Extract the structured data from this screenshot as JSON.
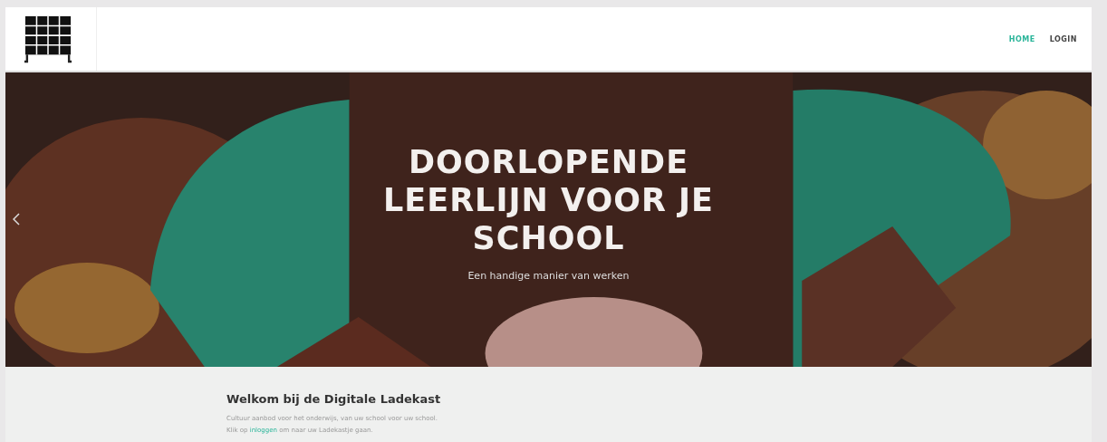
{
  "nav": [
    {
      "label": "HOME",
      "selected": true
    },
    {
      "label": "LOGIN",
      "selected": false
    }
  ],
  "hero": {
    "title": "DOORLOPENDE LEERLIJN VOOR JE SCHOOL",
    "subtitle": "Een handige manier van werken"
  },
  "intro": {
    "heading": "Welkom bij de Digitale Ladekast",
    "text": "Cultuur aanbod voor het onderwijs, van uw school voor uw school.",
    "link_line": {
      "before": "Klik op ",
      "link": "inloggen",
      "after": " om naar uw Ladekastje gaan."
    }
  }
}
